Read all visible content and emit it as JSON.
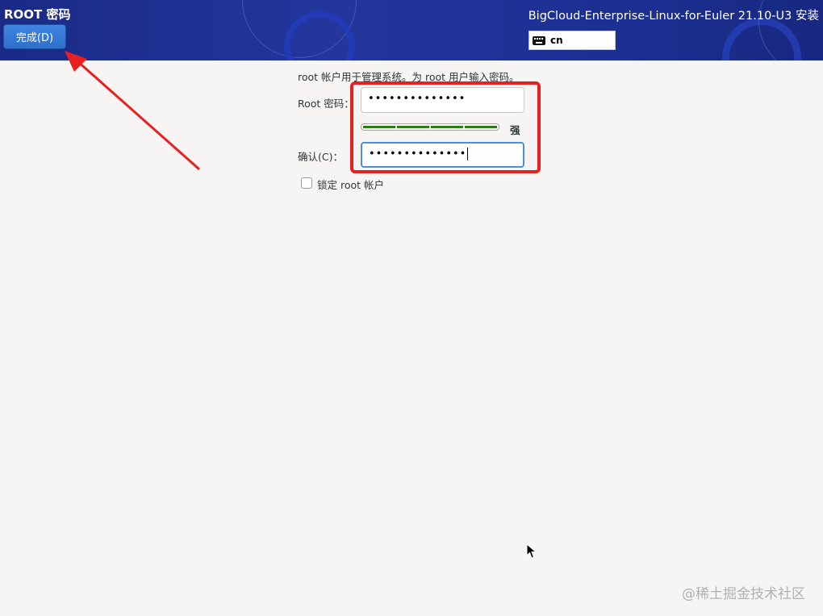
{
  "header": {
    "page_title": "ROOT 密码",
    "done_button": "完成(D)",
    "product_name": "BigCloud-Enterprise-Linux-for-Euler 21.10-U3 安装",
    "keyboard_layout": "cn",
    "keyboard_icon": "keyboard-icon"
  },
  "form": {
    "intro_text": "root 帐户用于管理系统。为 root 用户输入密码。",
    "root_password_label": "Root 密码：",
    "root_password_value": "••••••••••••••",
    "strength_label": "强",
    "strength_level": 1.0,
    "strength_color": "#2a7d14",
    "confirm_label": "确认(C)：",
    "confirm_password_value": "••••••••••••••",
    "lock_root_label": "锁定 root 帐户",
    "lock_root_checked": false
  },
  "annotation": {
    "highlight_color": "#e8201f"
  },
  "watermark": "@稀土掘金技术社区"
}
